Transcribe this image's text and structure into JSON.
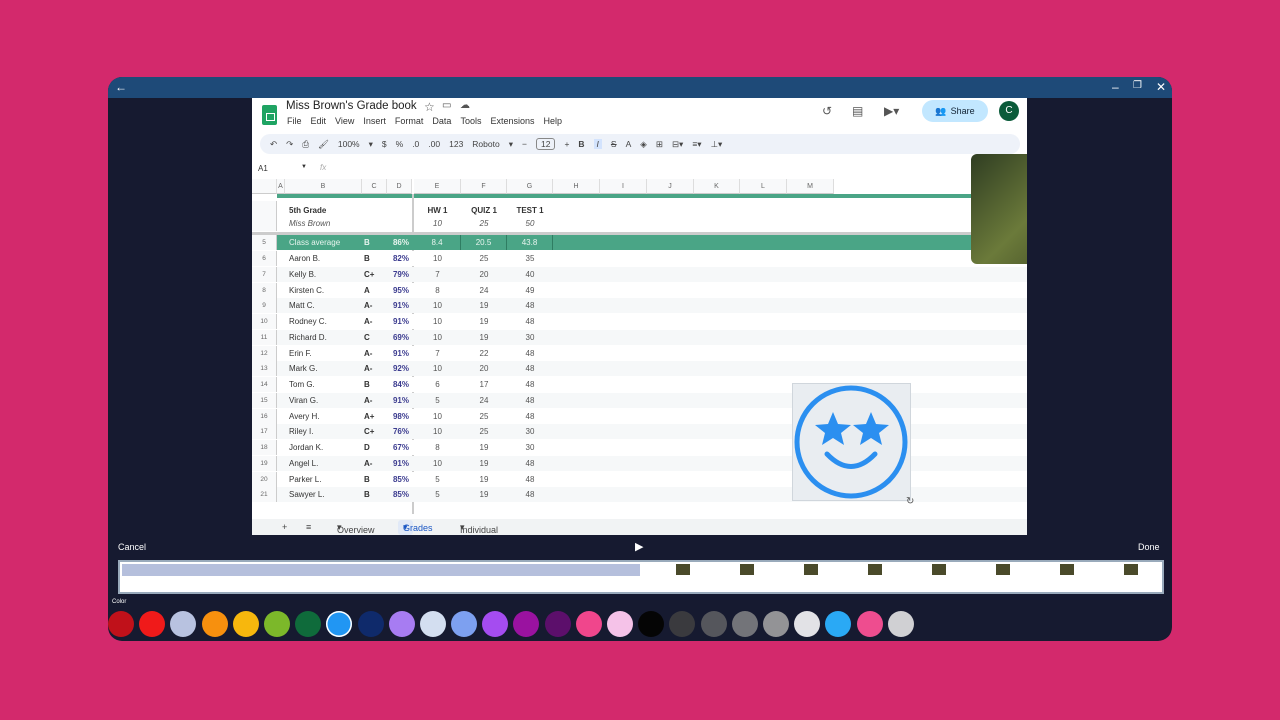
{
  "window": {
    "back": "←",
    "minimize": "–",
    "maximize": "❐",
    "close": "✕"
  },
  "doc": {
    "title": "Miss Brown's Grade book",
    "menus": [
      "File",
      "Edit",
      "View",
      "Insert",
      "Format",
      "Data",
      "Tools",
      "Extensions",
      "Help"
    ],
    "share": "Share",
    "avatar": "C"
  },
  "toolbar": {
    "zoom": "100%",
    "currency": "$",
    "percent": "%",
    "dec_less": ".0",
    "dec_more": ".00",
    "format": "123",
    "font": "Roboto",
    "font_size": "12",
    "bold": "B",
    "italic": "I",
    "strike": "S",
    "text_color": "A"
  },
  "formula": {
    "cell_ref": "A1",
    "fx": "fx"
  },
  "columns": [
    "A",
    "B",
    "C",
    "D",
    "E",
    "F",
    "G",
    "H",
    "I",
    "J",
    "K",
    "L",
    "M"
  ],
  "header": {
    "class": "5th Grade",
    "teacher": "Miss Brown",
    "assignments": [
      {
        "name": "HW 1",
        "max": "10"
      },
      {
        "name": "QUIZ 1",
        "max": "25"
      },
      {
        "name": "TEST 1",
        "max": "50"
      }
    ]
  },
  "average": {
    "row": "5",
    "label": "Class average",
    "grade": "B",
    "pct": "86%",
    "scores": [
      "8.4",
      "20.5",
      "43.8"
    ]
  },
  "students": [
    {
      "row": "6",
      "name": "Aaron B.",
      "grade": "B",
      "pct": "82%",
      "scores": [
        "10",
        "25",
        "35"
      ]
    },
    {
      "row": "7",
      "name": "Kelly B.",
      "grade": "C+",
      "pct": "79%",
      "scores": [
        "7",
        "20",
        "40"
      ]
    },
    {
      "row": "8",
      "name": "Kirsten C.",
      "grade": "A",
      "pct": "95%",
      "scores": [
        "8",
        "24",
        "49"
      ]
    },
    {
      "row": "9",
      "name": "Matt C.",
      "grade": "A-",
      "pct": "91%",
      "scores": [
        "10",
        "19",
        "48"
      ]
    },
    {
      "row": "10",
      "name": "Rodney C.",
      "grade": "A-",
      "pct": "91%",
      "scores": [
        "10",
        "19",
        "48"
      ]
    },
    {
      "row": "11",
      "name": "Richard D.",
      "grade": "C",
      "pct": "69%",
      "scores": [
        "10",
        "19",
        "30"
      ]
    },
    {
      "row": "12",
      "name": "Erin F.",
      "grade": "A-",
      "pct": "91%",
      "scores": [
        "7",
        "22",
        "48"
      ]
    },
    {
      "row": "13",
      "name": "Mark G.",
      "grade": "A-",
      "pct": "92%",
      "scores": [
        "10",
        "20",
        "48"
      ]
    },
    {
      "row": "14",
      "name": "Tom G.",
      "grade": "B",
      "pct": "84%",
      "scores": [
        "6",
        "17",
        "48"
      ]
    },
    {
      "row": "15",
      "name": "Viran G.",
      "grade": "A-",
      "pct": "91%",
      "scores": [
        "5",
        "24",
        "48"
      ]
    },
    {
      "row": "16",
      "name": "Avery H.",
      "grade": "A+",
      "pct": "98%",
      "scores": [
        "10",
        "25",
        "48"
      ]
    },
    {
      "row": "17",
      "name": "Riley I.",
      "grade": "C+",
      "pct": "76%",
      "scores": [
        "10",
        "25",
        "30"
      ]
    },
    {
      "row": "18",
      "name": "Jordan K.",
      "grade": "D",
      "pct": "67%",
      "scores": [
        "8",
        "19",
        "30"
      ]
    },
    {
      "row": "19",
      "name": "Angel L.",
      "grade": "A-",
      "pct": "91%",
      "scores": [
        "10",
        "19",
        "48"
      ]
    },
    {
      "row": "20",
      "name": "Parker L.",
      "grade": "B",
      "pct": "85%",
      "scores": [
        "5",
        "19",
        "48"
      ]
    },
    {
      "row": "21",
      "name": "Sawyer L.",
      "grade": "B",
      "pct": "85%",
      "scores": [
        "5",
        "19",
        "48"
      ]
    }
  ],
  "tabs": {
    "add": "+",
    "all": "≡",
    "items": [
      "Overview",
      "Grades",
      "Individual report"
    ],
    "active": "Grades"
  },
  "editor": {
    "cancel": "Cancel",
    "done": "Done",
    "play": "▶",
    "color_label": "Color",
    "selected_color": "#2196f3",
    "colors": [
      "#c0111a",
      "#f01a1a",
      "#b8c2e0",
      "#f7900e",
      "#f7b70d",
      "#7cb82a",
      "#0f6b3b",
      "#2196f3",
      "#0f2a6b",
      "#a77cf2",
      "#d3def0",
      "#7da0f0",
      "#a54cf0",
      "#9a12a0",
      "#5c0f6b",
      "#f0468c",
      "#f5c2e8",
      "#050505",
      "#3a3a3e",
      "#55565c",
      "#737479",
      "#939396",
      "#e2e2e6",
      "#2aa9f5",
      "#ee4d8f",
      "#d0d0d3"
    ]
  }
}
